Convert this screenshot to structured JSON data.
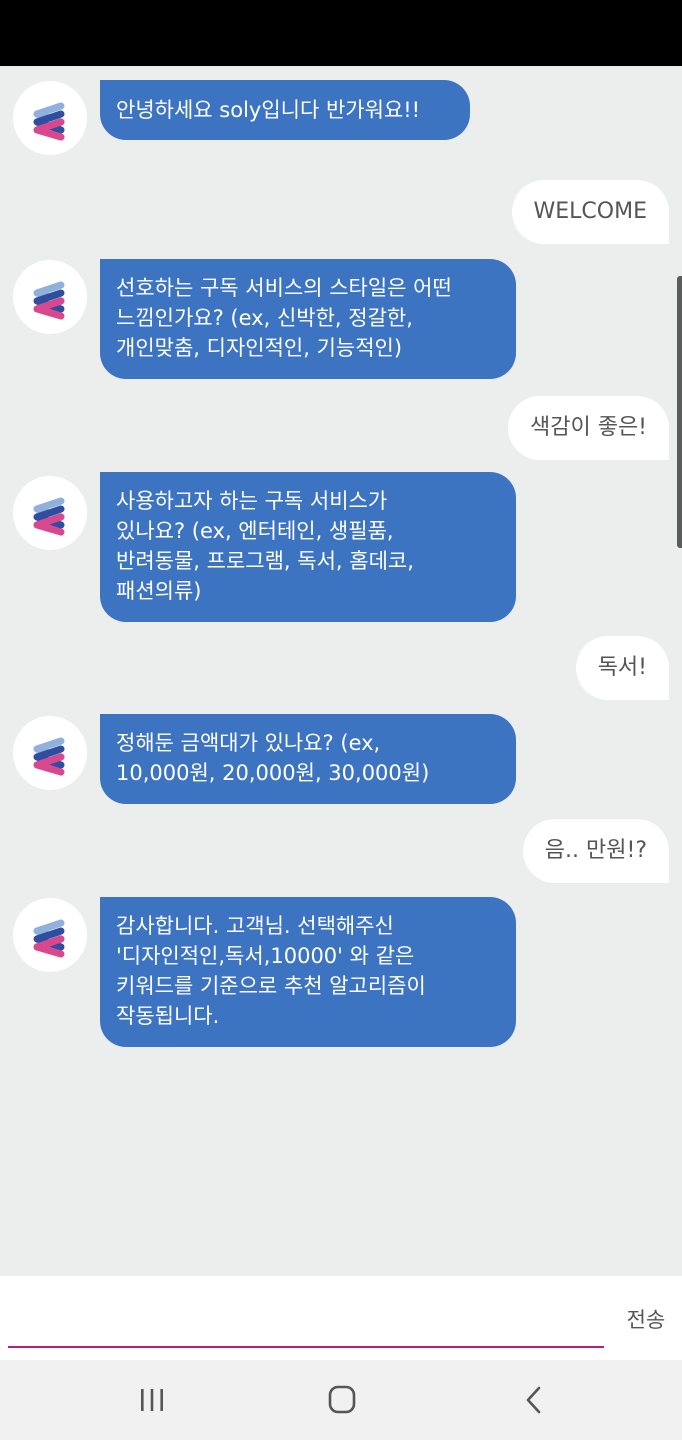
{
  "messages": [
    {
      "sender": "bot",
      "text": "안녕하세요 soly입니다 반가워요!!"
    },
    {
      "sender": "user",
      "text": "WELCOME"
    },
    {
      "sender": "bot",
      "text": "선호하는 구독 서비스의 스타일은 어떤\n느낌인가요? (ex, 신박한, 정갈한,\n개인맞춤, 디자인적인, 기능적인)"
    },
    {
      "sender": "user",
      "text": "색감이 좋은!"
    },
    {
      "sender": "bot",
      "text": "사용하고자 하는 구독 서비스가\n있나요? (ex, 엔터테인, 생필품,\n반려동물, 프로그램, 독서, 홈데코,\n패션의류)"
    },
    {
      "sender": "user",
      "text": "독서!"
    },
    {
      "sender": "bot",
      "text": "정해둔 금액대가 있나요? (ex,\n10,000원, 20,000원, 30,000원)"
    },
    {
      "sender": "user",
      "text": "음.. 만원!?"
    },
    {
      "sender": "bot",
      "text": "감사합니다. 고객님. 선택해주신\n'디자인적인,독서,10000'  와 같은\n키워드를 기준으로 추천 알고리즘이\n작동됩니다."
    }
  ],
  "composer": {
    "placeholder": "",
    "send_label": "전송"
  },
  "icons": {
    "bot_avatar": "soly-logo-icon",
    "nav": [
      "recent-apps-icon",
      "home-icon",
      "back-icon"
    ]
  },
  "colors": {
    "bot_bubble": "#3d74c1",
    "user_bubble": "#ffffff",
    "input_underline": "#b5217b",
    "background": "#eceeed"
  }
}
